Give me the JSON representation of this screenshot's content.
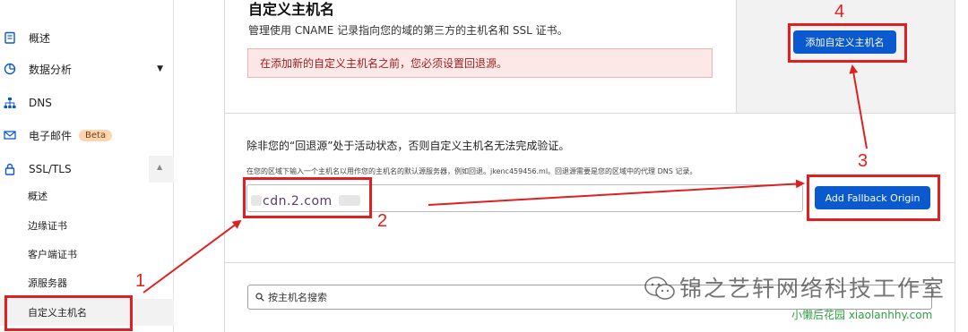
{
  "sidebar": {
    "items": [
      {
        "label": "概述",
        "icon": "clipboard-icon"
      },
      {
        "label": "数据分析",
        "icon": "clock-chart-icon"
      },
      {
        "label": "DNS",
        "icon": "network-icon"
      },
      {
        "label": "电子邮件",
        "icon": "mail-icon",
        "badge": "Beta"
      },
      {
        "label": "SSL/TLS",
        "icon": "lock-icon"
      }
    ],
    "sub_items": [
      "概述",
      "边缘证书",
      "客户端证书",
      "源服务器",
      "自定义主机名"
    ]
  },
  "main": {
    "title": "自定义主机名",
    "description": "管理使用 CNAME 记录指向您的域的第三方的主机名和 SSL 证书。",
    "warning": "在添加新的自定义主机名之前，您必须设置回退源。",
    "add_button": "添加自定义主机名",
    "fallback_notice": "除非您的“回退源”处于活动状态，否则自定义主机名无法完成验证。",
    "fallback_help": "在您的区域下输入一个主机名以用作您的主机名的默认源服务器，例如回退。jkenc459456.ml。回退源需要是您的区域中的代理 DNS 记录。",
    "fallback_value": "cdn.2.com",
    "fallback_button": "Add Fallback Origin",
    "search_placeholder": "按主机名搜索"
  },
  "annotations": [
    "1",
    "2",
    "3",
    "4"
  ],
  "watermark": {
    "main": "锦之艺轩网络科技工作室",
    "sub": "小懒后花园 xiaolanhhy.com"
  },
  "colors": {
    "accent": "#0b59cf",
    "annotation": "#e02020",
    "warning_bg": "#fde8e8",
    "beta_bg": "#fbd6b0"
  }
}
